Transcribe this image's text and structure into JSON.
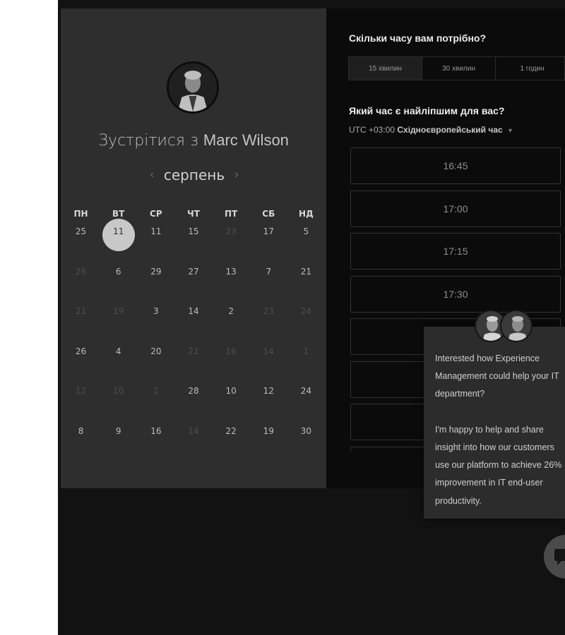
{
  "host": {
    "title_prefix": "Зустрітися з",
    "name": "Marc Wilson"
  },
  "calendar": {
    "month": "серпень",
    "prev_icon": "chevron-left-icon",
    "next_icon": "chevron-right-icon",
    "weekdays": [
      "ПН",
      "ВТ",
      "СР",
      "ЧТ",
      "ПТ",
      "СБ",
      "НД"
    ],
    "weeks": [
      [
        {
          "d": "25",
          "off": false
        },
        {
          "d": "11",
          "off": false,
          "selected": true
        },
        {
          "d": "11",
          "off": false
        },
        {
          "d": "15",
          "off": false
        },
        {
          "d": "23",
          "off": true
        },
        {
          "d": "17",
          "off": false
        },
        {
          "d": "5",
          "off": false
        }
      ],
      [
        {
          "d": "26",
          "off": true
        },
        {
          "d": "6",
          "off": false
        },
        {
          "d": "29",
          "off": false
        },
        {
          "d": "27",
          "off": false
        },
        {
          "d": "13",
          "off": false
        },
        {
          "d": "7",
          "off": false
        },
        {
          "d": "21",
          "off": false
        }
      ],
      [
        {
          "d": "21",
          "off": true
        },
        {
          "d": "19",
          "off": true
        },
        {
          "d": "3",
          "off": false
        },
        {
          "d": "14",
          "off": false
        },
        {
          "d": "2",
          "off": false
        },
        {
          "d": "23",
          "off": true
        },
        {
          "d": "24",
          "off": true
        }
      ],
      [
        {
          "d": "26",
          "off": false
        },
        {
          "d": "4",
          "off": false
        },
        {
          "d": "20",
          "off": false
        },
        {
          "d": "21",
          "off": true
        },
        {
          "d": "16",
          "off": true
        },
        {
          "d": "14",
          "off": true
        },
        {
          "d": "1",
          "off": true
        }
      ],
      [
        {
          "d": "12",
          "off": true
        },
        {
          "d": "10",
          "off": true
        },
        {
          "d": "2",
          "off": true
        },
        {
          "d": "28",
          "off": false
        },
        {
          "d": "10",
          "off": false
        },
        {
          "d": "12",
          "off": false
        },
        {
          "d": "24",
          "off": false
        }
      ],
      [
        {
          "d": "8",
          "off": false
        },
        {
          "d": "9",
          "off": false
        },
        {
          "d": "16",
          "off": false
        },
        {
          "d": "14",
          "off": true
        },
        {
          "d": "22",
          "off": false
        },
        {
          "d": "19",
          "off": false
        },
        {
          "d": "30",
          "off": false
        }
      ]
    ]
  },
  "booking": {
    "duration_question": "Скільки часу вам потрібно?",
    "durations": [
      "15 хвилин",
      "30 хвилин",
      "1 годин"
    ],
    "time_question": "Який час є найліпшим для вас?",
    "timezone_offset": "UTC +03:00",
    "timezone_name": "Східноєвропейський час",
    "slots": [
      "16:45",
      "17:00",
      "17:15",
      "17:30",
      "",
      "",
      "",
      ""
    ]
  },
  "chat": {
    "lines_1": [
      "Interested how Experience",
      "Management could help your IT",
      "department?"
    ],
    "lines_2": [
      "I'm happy to help and share",
      "insight into how our customers",
      "use our platform to achieve 26%",
      "improvement in IT end-user",
      "productivity."
    ],
    "launcher_icon": "chat-bubble-icon"
  }
}
